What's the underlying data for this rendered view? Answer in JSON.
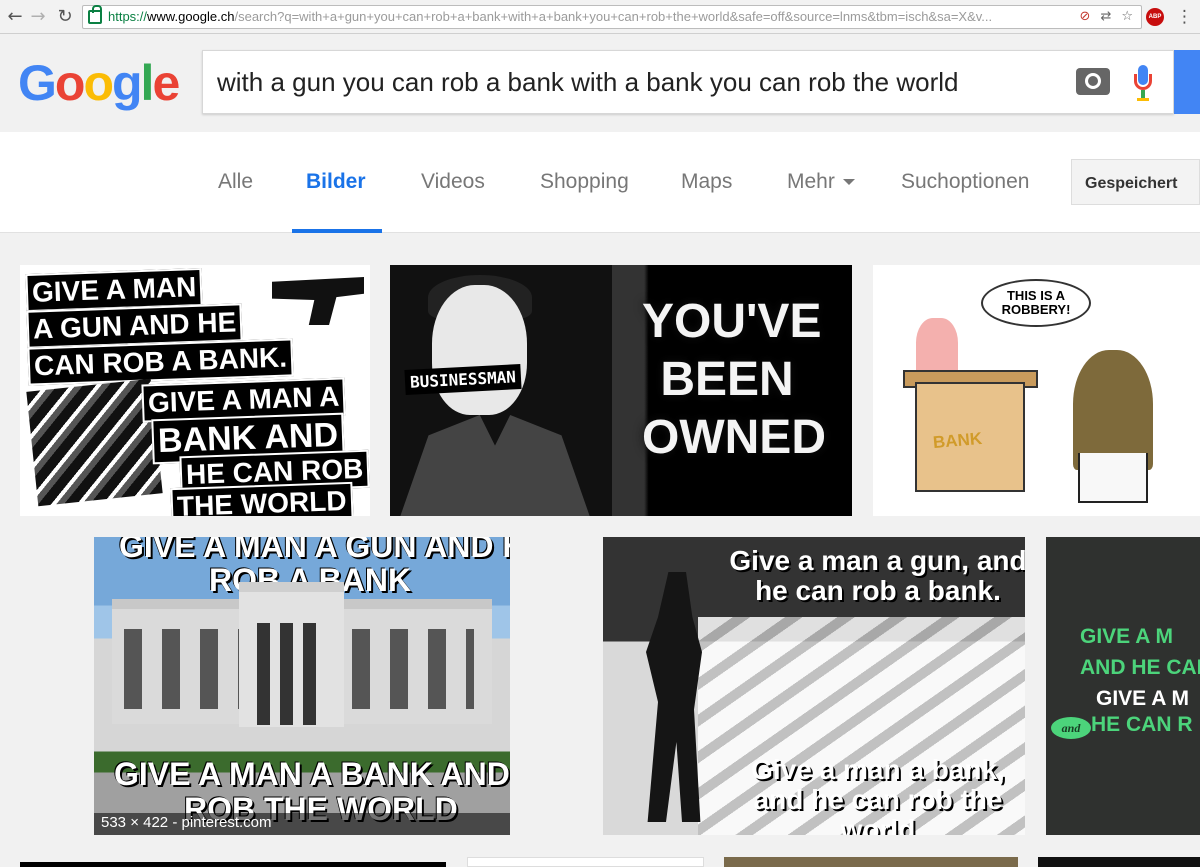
{
  "browser": {
    "url_prefix": "https://",
    "url_domain": "www.google.ch",
    "url_rest": "/search?q=with+a+gun+you+can+rob+a+bank+with+a+bank+you+can+rob+the+world&safe=off&source=lnms&tbm=isch&sa=X&v...",
    "abp_badge": "ABP"
  },
  "header": {
    "logo": "Google",
    "query": "with a gun you can rob a bank with a bank you can rob the world"
  },
  "tabs": [
    {
      "label": "Alle"
    },
    {
      "label": "Bilder",
      "active": true
    },
    {
      "label": "Videos"
    },
    {
      "label": "Shopping"
    },
    {
      "label": "Maps"
    },
    {
      "label": "Mehr"
    },
    {
      "label": "Suchoptionen"
    }
  ],
  "saved_label": "Gespeichert",
  "results": {
    "image1": {
      "lines": [
        "GIVE A MAN",
        "A GUN AND HE",
        "CAN ROB A BANK.",
        "GIVE A MAN A",
        "BANK AND",
        "HE CAN ROB",
        "THE WORLD"
      ]
    },
    "image2": {
      "label": "BUSINESSMAN",
      "text": [
        "YOU'VE",
        "BEEN",
        "OWNED"
      ]
    },
    "image3": {
      "bubble": "THIS IS A ROBBERY!",
      "bank": "BANK"
    },
    "image4": {
      "top_text": "GIVE A MAN A GUN AND HE CAN",
      "top_text_2": "ROB A BANK",
      "bottom_text": "GIVE A MAN A BANK AND HE CAN",
      "bottom_text_2": "ROB THE WORLD",
      "caption": "533 × 422 - pinterest.com"
    },
    "image5": {
      "top_text": "Give a man a gun, and he can rob a bank.",
      "bottom_text": "Give a man a bank, and he can rob the world"
    },
    "image6": {
      "line1": "GIVE A M",
      "line2": "AND HE CAN",
      "line3": "GIVE A M",
      "line4": "HE CAN R",
      "and": "and"
    }
  },
  "colors": {
    "active_tab": "#1a73e8",
    "google_blue": "#4285f4",
    "google_red": "#ea4335",
    "google_yellow": "#fbbc05",
    "google_green": "#34a853"
  },
  "icons": {
    "back": "back-arrow-icon",
    "forward": "forward-arrow-icon",
    "reload": "reload-icon",
    "secure": "lock-icon",
    "camera": "camera-icon",
    "mic": "microphone-icon",
    "menu": "vertical-dots-icon"
  }
}
